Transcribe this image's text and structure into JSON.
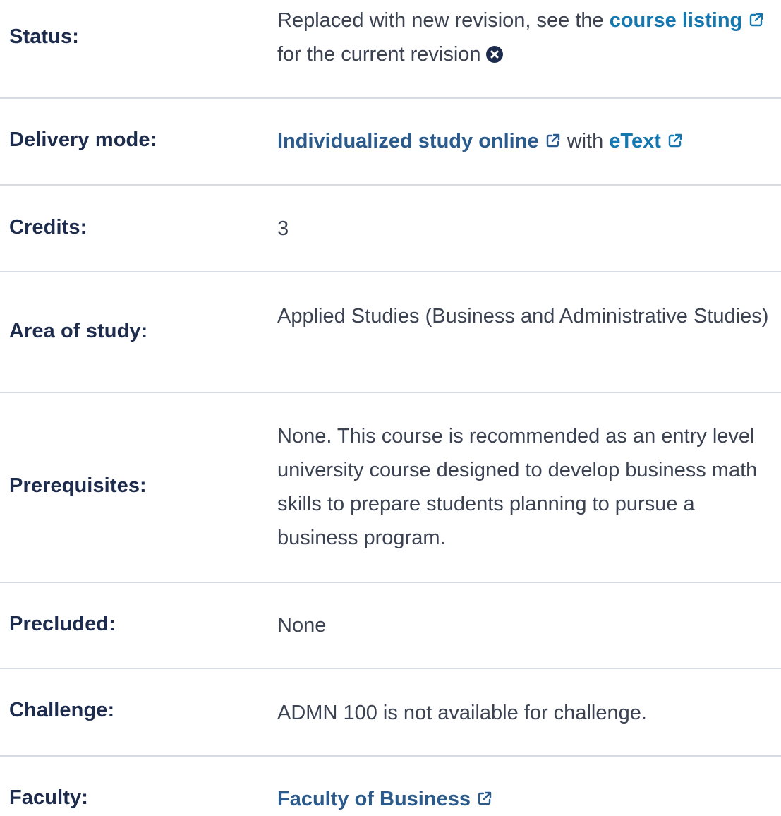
{
  "colors": {
    "label": "#1d2b4c",
    "text": "#3b4252",
    "link": "#1577b0",
    "divider": "#d7dbe2"
  },
  "rows": {
    "status": {
      "label": "Status:",
      "prefix": "Replaced with new revision, see the ",
      "link": "course listing",
      "suffix": " for the current revision"
    },
    "delivery": {
      "label": "Delivery mode:",
      "link1": "Individualized study online",
      "middle": " with ",
      "link2": "eText"
    },
    "credits": {
      "label": "Credits:",
      "value": "3"
    },
    "area": {
      "label": "Area of study:",
      "value": "Applied Studies (Business and Administrative Studies)"
    },
    "prereq": {
      "label": "Prerequisites:",
      "value": "None. This course is recommended as an entry level university course designed to develop business math skills to prepare students planning to pursue a business program."
    },
    "precluded": {
      "label": "Precluded:",
      "value": "None"
    },
    "challenge": {
      "label": "Challenge:",
      "value": "ADMN 100 is not available for challenge."
    },
    "faculty": {
      "label": "Faculty:",
      "link": "Faculty of Business"
    }
  }
}
